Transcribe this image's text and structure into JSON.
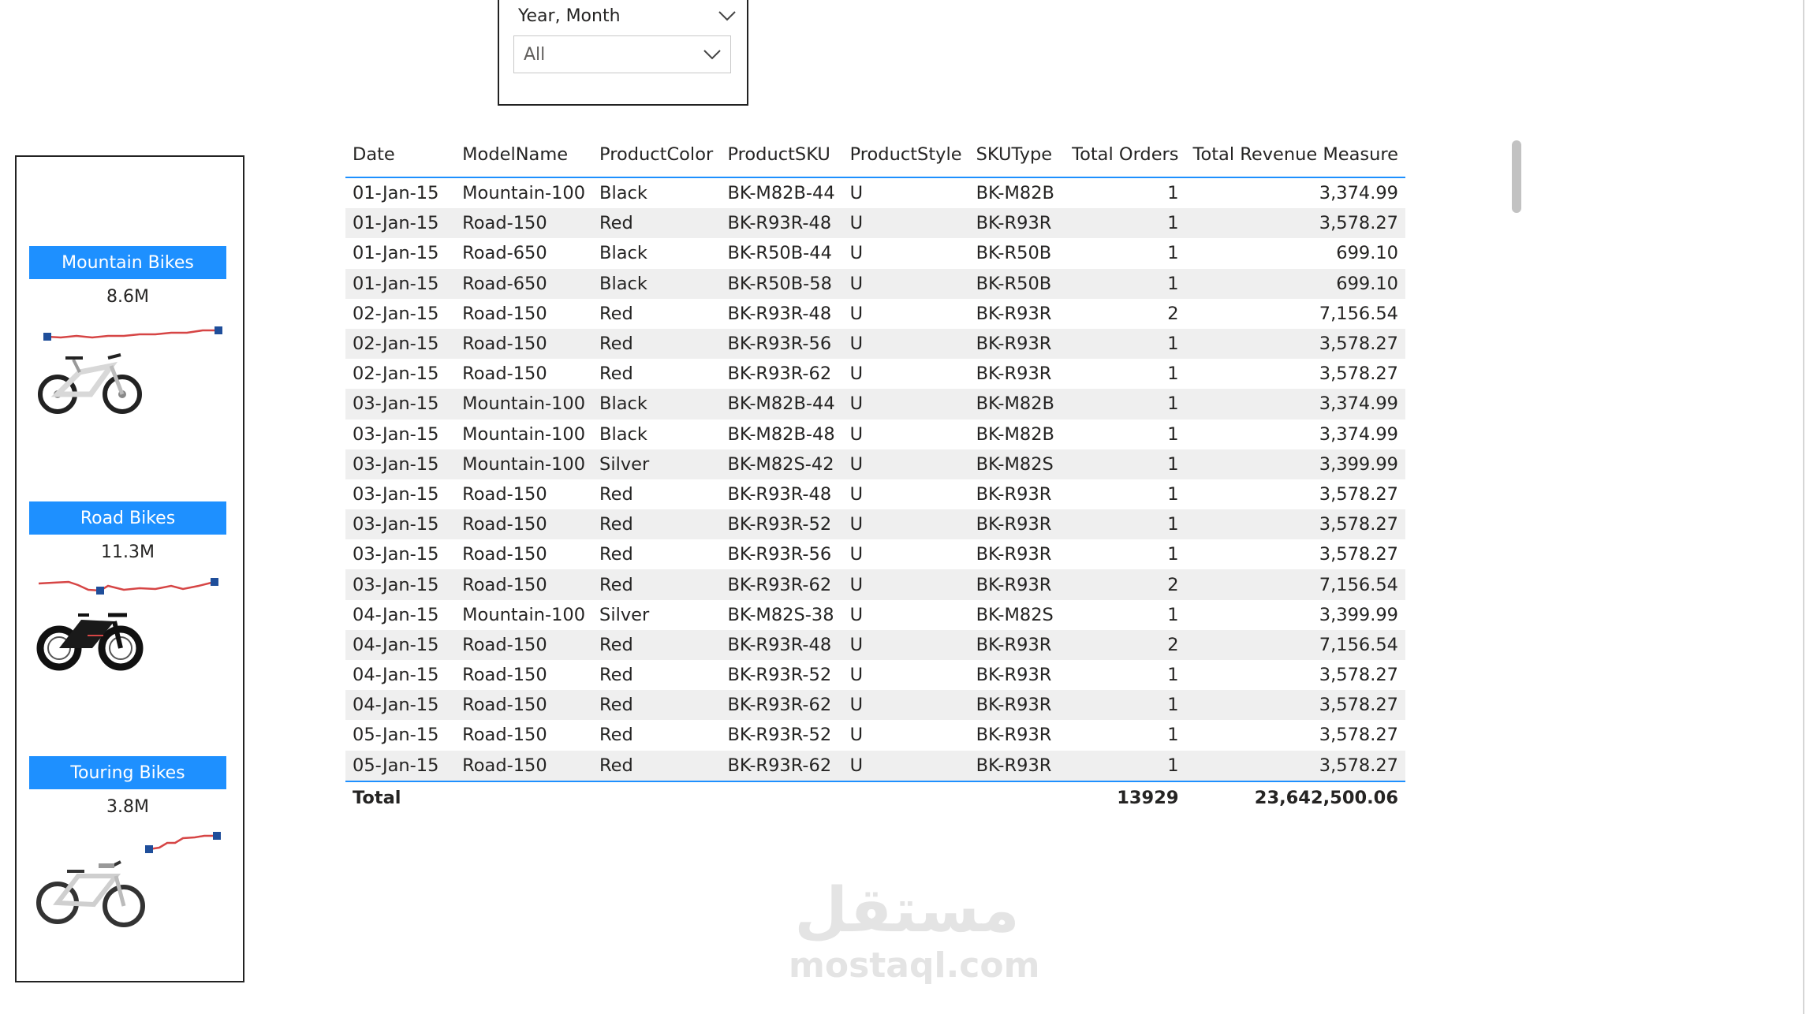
{
  "slicer": {
    "title": "Year, Month",
    "value": "All"
  },
  "categories": [
    {
      "label": "Mountain Bikes",
      "value": "8.6M"
    },
    {
      "label": "Road Bikes",
      "value": "11.3M"
    },
    {
      "label": "Touring Bikes",
      "value": "3.8M"
    }
  ],
  "table": {
    "columns": [
      "Date",
      "ModelName",
      "ProductColor",
      "ProductSKU",
      "ProductStyle",
      "SKUType",
      "Total Orders",
      "Total Revenue Measure"
    ],
    "rows": [
      [
        "01-Jan-15",
        "Mountain-100",
        "Black",
        "BK-M82B-44",
        "U",
        "BK-M82B",
        "1",
        "3,374.99"
      ],
      [
        "01-Jan-15",
        "Road-150",
        "Red",
        "BK-R93R-48",
        "U",
        "BK-R93R",
        "1",
        "3,578.27"
      ],
      [
        "01-Jan-15",
        "Road-650",
        "Black",
        "BK-R50B-44",
        "U",
        "BK-R50B",
        "1",
        "699.10"
      ],
      [
        "01-Jan-15",
        "Road-650",
        "Black",
        "BK-R50B-58",
        "U",
        "BK-R50B",
        "1",
        "699.10"
      ],
      [
        "02-Jan-15",
        "Road-150",
        "Red",
        "BK-R93R-48",
        "U",
        "BK-R93R",
        "2",
        "7,156.54"
      ],
      [
        "02-Jan-15",
        "Road-150",
        "Red",
        "BK-R93R-56",
        "U",
        "BK-R93R",
        "1",
        "3,578.27"
      ],
      [
        "02-Jan-15",
        "Road-150",
        "Red",
        "BK-R93R-62",
        "U",
        "BK-R93R",
        "1",
        "3,578.27"
      ],
      [
        "03-Jan-15",
        "Mountain-100",
        "Black",
        "BK-M82B-44",
        "U",
        "BK-M82B",
        "1",
        "3,374.99"
      ],
      [
        "03-Jan-15",
        "Mountain-100",
        "Black",
        "BK-M82B-48",
        "U",
        "BK-M82B",
        "1",
        "3,374.99"
      ],
      [
        "03-Jan-15",
        "Mountain-100",
        "Silver",
        "BK-M82S-42",
        "U",
        "BK-M82S",
        "1",
        "3,399.99"
      ],
      [
        "03-Jan-15",
        "Road-150",
        "Red",
        "BK-R93R-48",
        "U",
        "BK-R93R",
        "1",
        "3,578.27"
      ],
      [
        "03-Jan-15",
        "Road-150",
        "Red",
        "BK-R93R-52",
        "U",
        "BK-R93R",
        "1",
        "3,578.27"
      ],
      [
        "03-Jan-15",
        "Road-150",
        "Red",
        "BK-R93R-56",
        "U",
        "BK-R93R",
        "1",
        "3,578.27"
      ],
      [
        "03-Jan-15",
        "Road-150",
        "Red",
        "BK-R93R-62",
        "U",
        "BK-R93R",
        "2",
        "7,156.54"
      ],
      [
        "04-Jan-15",
        "Mountain-100",
        "Silver",
        "BK-M82S-38",
        "U",
        "BK-M82S",
        "1",
        "3,399.99"
      ],
      [
        "04-Jan-15",
        "Road-150",
        "Red",
        "BK-R93R-48",
        "U",
        "BK-R93R",
        "2",
        "7,156.54"
      ],
      [
        "04-Jan-15",
        "Road-150",
        "Red",
        "BK-R93R-52",
        "U",
        "BK-R93R",
        "1",
        "3,578.27"
      ],
      [
        "04-Jan-15",
        "Road-150",
        "Red",
        "BK-R93R-62",
        "U",
        "BK-R93R",
        "1",
        "3,578.27"
      ],
      [
        "05-Jan-15",
        "Road-150",
        "Red",
        "BK-R93R-52",
        "U",
        "BK-R93R",
        "1",
        "3,578.27"
      ],
      [
        "05-Jan-15",
        "Road-150",
        "Red",
        "BK-R93R-62",
        "U",
        "BK-R93R",
        "1",
        "3,578.27"
      ]
    ],
    "total": {
      "label": "Total",
      "orders": "13929",
      "revenue": "23,642,500.06"
    }
  },
  "watermark": {
    "arabic": "مستقل",
    "latin": "mostaql.com"
  },
  "colors": {
    "accent": "#1e90ff",
    "sparkline": "#d64545",
    "marker": "#1f4e9a"
  }
}
